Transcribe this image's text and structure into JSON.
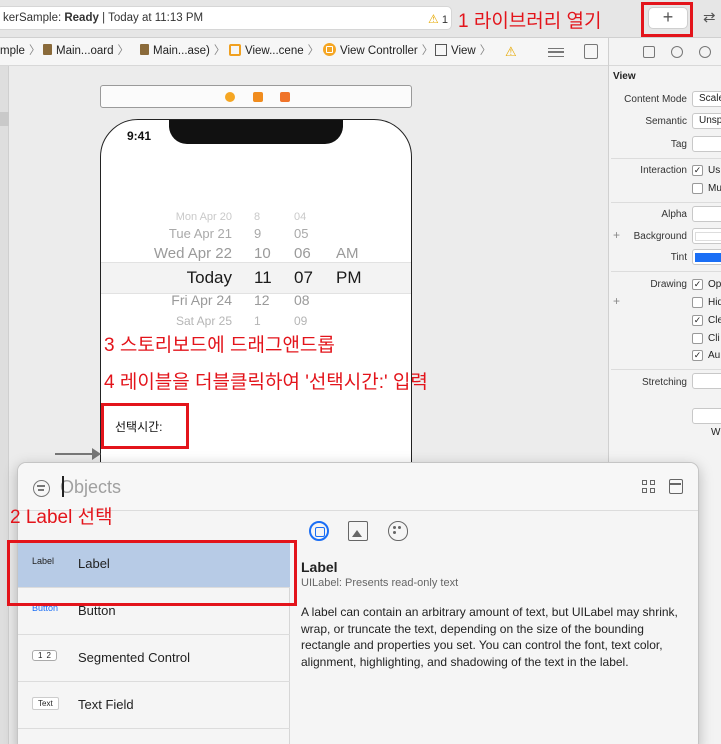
{
  "toolbar": {
    "status_prefix": "kerSample: ",
    "status_state": "Ready",
    "status_sep": " | ",
    "status_time": "Today at 11:13 PM",
    "warning_count": "1",
    "add_label": "+"
  },
  "jumpbar": {
    "crumbs": [
      "mple",
      "Main...oard",
      "Main...ase)",
      "View...cene",
      "View Controller",
      "View"
    ]
  },
  "canvas": {
    "phone_time": "9:41",
    "picker_rows": [
      {
        "date": "Mon Apr 20",
        "hour": "8",
        "minute": "04",
        "ampm": ""
      },
      {
        "date": "Tue Apr 21",
        "hour": "9",
        "minute": "05",
        "ampm": ""
      },
      {
        "date": "Wed Apr 22",
        "hour": "10",
        "minute": "06",
        "ampm": "AM"
      },
      {
        "date": "Today",
        "hour": "11",
        "minute": "07",
        "ampm": "PM"
      },
      {
        "date": "Fri Apr 24",
        "hour": "12",
        "minute": "08",
        "ampm": ""
      },
      {
        "date": "Sat Apr 25",
        "hour": "1",
        "minute": "09",
        "ampm": ""
      }
    ],
    "label_text": "선택시간:"
  },
  "annotations": {
    "step1": "1 라이브러리 열기",
    "step2": "2 Label 선택",
    "step3": "3 스토리보드에 드래그앤드롭",
    "step4": "4 레이블을 더블클릭하여 '선택시간:' 입력"
  },
  "inspector": {
    "section_title": "View",
    "content_mode_label": "Content Mode",
    "content_mode_value": "Scale",
    "semantic_label": "Semantic",
    "semantic_value": "Unsp",
    "tag_label": "Tag",
    "interaction_label": "Interaction",
    "interaction_opt1": "Us",
    "interaction_opt2": "Mu",
    "alpha_label": "Alpha",
    "background_label": "Background",
    "tint_label": "Tint",
    "drawing_label": "Drawing",
    "drawing_opts": [
      "Op",
      "Hid",
      "Cle",
      "Cli",
      "Au"
    ],
    "stretching_label": "Stretching",
    "w_label": "W"
  },
  "library": {
    "search_placeholder": "Objects",
    "items": [
      {
        "thumb": "Label",
        "name": "Label"
      },
      {
        "thumb": "Button",
        "name": "Button"
      },
      {
        "thumb_seg": [
          "1",
          "2"
        ],
        "name": "Segmented Control"
      },
      {
        "thumb": "Text",
        "name": "Text Field"
      }
    ],
    "detail": {
      "title": "Label",
      "subtitle": "UILabel: Presents read-only text",
      "body": "A label can contain an arbitrary amount of text, but UILabel may shrink, wrap, or truncate the text, depending on the size of the bounding rectangle and properties you set. You can control the font, text color, alignment, highlighting, and shadowing of the text in the label."
    }
  },
  "colors": {
    "annotation_red": "#e3141b",
    "accent_blue": "#1a6ef5",
    "selection_blue": "#b7cbe6"
  }
}
